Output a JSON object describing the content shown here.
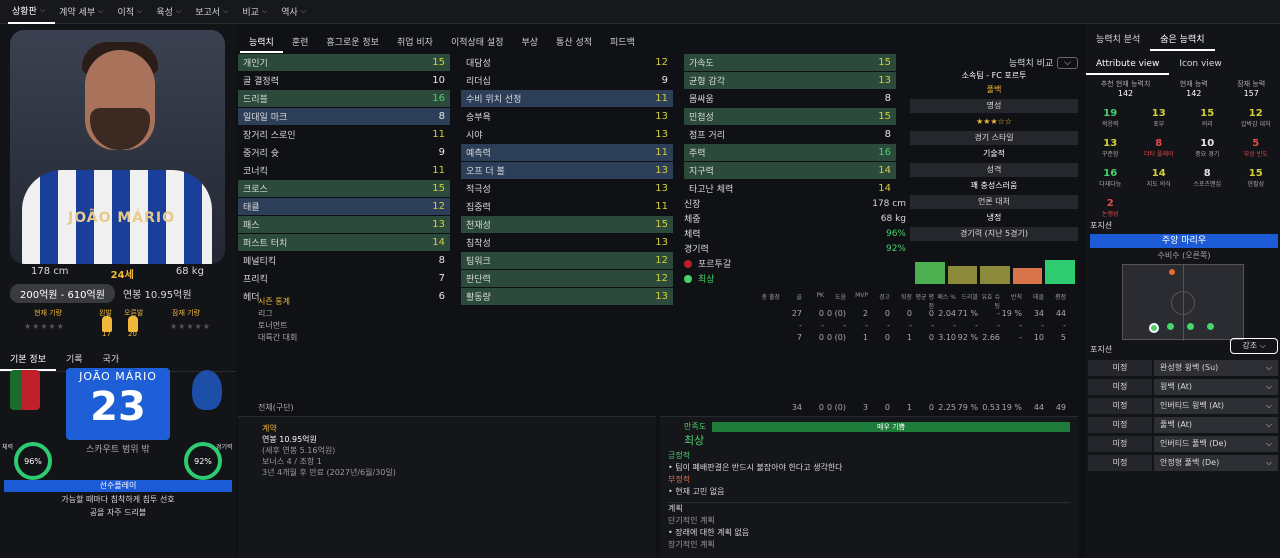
{
  "topnav": [
    "상황판",
    "계약 세부",
    "이적",
    "육성",
    "보고서",
    "비교",
    "역사"
  ],
  "player": {
    "name": "JOÃO MÁRIO",
    "height": "178 cm",
    "age": "24세",
    "weight": "68 kg",
    "value": "200억원 - 610억원",
    "wage": "연봉 10.95억원",
    "cur_label": "현재 기량",
    "left_foot": "왼발",
    "right_foot": "오른발",
    "left_val": "17",
    "right_val": "20",
    "pot_label": "잠재 기량",
    "number": "23",
    "scout": "스카우트 범위 밖",
    "cond_label": "체력",
    "cond": "96%",
    "sharp_label": "경기력",
    "sharp": "92%",
    "playstyle": "선수플레이",
    "ps_desc1": "가능할 때마다 침착하게 침투 선호",
    "ps_desc2": "공을 자주 드리블"
  },
  "lefttabs": [
    "기본 정보",
    "기록",
    "국가"
  ],
  "midtabs": [
    "능력치",
    "훈련",
    "흥그로운 정보",
    "취업 비자",
    "이적상태 설정",
    "부상",
    "통산 성적",
    "피드백"
  ],
  "col1": [
    [
      "개인기",
      "15",
      "hl1",
      "vy"
    ],
    [
      "골 결정력",
      "10",
      "",
      "vw"
    ],
    [
      "드리블",
      "16",
      "hl1",
      "vg"
    ],
    [
      "일대일 마크",
      "8",
      "hl2",
      "vw"
    ],
    [
      "장거리 스로인",
      "11",
      "",
      "vy"
    ],
    [
      "중거리 슛",
      "9",
      "",
      "vw"
    ],
    [
      "코너킥",
      "11",
      "",
      "vy"
    ],
    [
      "크로스",
      "15",
      "hl1",
      "vy"
    ],
    [
      "태클",
      "12",
      "hl2",
      "vy"
    ],
    [
      "패스",
      "13",
      "hl1",
      "vy"
    ],
    [
      "퍼스트 터치",
      "14",
      "hl1",
      "vy"
    ],
    [
      "페널티킥",
      "8",
      "",
      "vw"
    ],
    [
      "프리킥",
      "7",
      "",
      "vw"
    ],
    [
      "헤더",
      "6",
      "",
      "vw"
    ]
  ],
  "col2": [
    [
      "대담성",
      "12",
      "",
      "vy"
    ],
    [
      "리더십",
      "9",
      "",
      "vw"
    ],
    [
      "수비 위치 선정",
      "11",
      "hl2",
      "vy"
    ],
    [
      "승부욕",
      "13",
      "",
      "vy"
    ],
    [
      "시야",
      "13",
      "",
      "vy"
    ],
    [
      "예측력",
      "11",
      "hl2",
      "vy"
    ],
    [
      "오프 더 볼",
      "13",
      "hl2",
      "vy"
    ],
    [
      "적극성",
      "13",
      "",
      "vy"
    ],
    [
      "집중력",
      "11",
      "",
      "vy"
    ],
    [
      "천재성",
      "15",
      "hl1",
      "vy"
    ],
    [
      "침착성",
      "13",
      "",
      "vy"
    ],
    [
      "팀워크",
      "12",
      "hl1",
      "vy"
    ],
    [
      "판단력",
      "12",
      "hl1",
      "vy"
    ],
    [
      "활동량",
      "13",
      "hl1",
      "vy"
    ]
  ],
  "col3": [
    [
      "가속도",
      "15",
      "hl1",
      "vy"
    ],
    [
      "균형 감각",
      "13",
      "hl1",
      "vy"
    ],
    [
      "몸싸움",
      "8",
      "",
      "vw"
    ],
    [
      "민첩성",
      "15",
      "hl1",
      "vy"
    ],
    [
      "점프 거리",
      "8",
      "",
      "vw"
    ],
    [
      "주력",
      "16",
      "hl1",
      "vg"
    ],
    [
      "지구력",
      "14",
      "hl1",
      "vy"
    ],
    [
      "타고난 체력",
      "14",
      "",
      "vy"
    ]
  ],
  "bio": [
    [
      "신장",
      "178 cm"
    ],
    [
      "체중",
      "68 kg"
    ],
    [
      "체력",
      "96%"
    ],
    [
      "경기력",
      "92%"
    ],
    [
      "",
      "포르투갈"
    ],
    [
      "",
      "최상"
    ]
  ],
  "rightattr": {
    "compare": "능력치 비교",
    "club": "소속팀 - FC 포르투",
    "pos": "풀백",
    "rep": "명성",
    "style_t": "경기 스타일",
    "style": "기술적",
    "pers_t": "성격",
    "pers": "꽤 충성스러움",
    "media_t": "언론 대처",
    "media": "냉정",
    "form_t": "경기력 (지난 5경기)"
  },
  "season": {
    "title": "시즌 통계",
    "headers": [
      "총 출장",
      "골",
      "PK",
      "도움",
      "MVP",
      "경고",
      "퇴장",
      "평균 평점",
      "패스 %",
      "드리블",
      "유효 슈팅",
      "반칙",
      "태클",
      "평점"
    ],
    "rows": [
      [
        "리그",
        "27",
        "0",
        "0 (0)",
        "2",
        "0",
        "0",
        "0",
        "2.04",
        "71 %",
        "-",
        "19 %",
        "34",
        "44"
      ],
      [
        "토너먼트",
        "-",
        "-",
        "-",
        "-",
        "-",
        "-",
        "-",
        "-",
        "-",
        "-",
        "-",
        "-",
        "-"
      ],
      [
        "대륙간 대회",
        "7",
        "0",
        "0 (0)",
        "1",
        "0",
        "1",
        "0",
        "3.10",
        "92 %",
        "2.66",
        "-",
        "10",
        "5"
      ]
    ],
    "total": [
      "전체(구단)",
      "34",
      "0",
      "0 (0)",
      "3",
      "0",
      "1",
      "0",
      "2.25",
      "79 %",
      "0.53",
      "19 %",
      "44",
      "49"
    ]
  },
  "contract": {
    "title": "계약",
    "wage": "연봉 10.95억원",
    "after": "(세후 연봉 5.16억원)",
    "bonus": "보너스 4 / 조항 1",
    "expire": "3년 4개월 후 만료 (2027년/6월/30일)"
  },
  "satis": {
    "title": "만족도",
    "level": "최상",
    "bar": "매우 기쁨",
    "pos_t": "긍정적",
    "pos": "팀이 폐배판결은 반드시 불잡아야 한다고 생각한다",
    "neg_t": "부정적",
    "neg": "현재 고민 없음",
    "plan_t": "계획",
    "short_t": "단기적인 계획",
    "short": "장래에 대한 계획 없음",
    "long_t": "장기적인 계획"
  },
  "rightpanel": {
    "tabs": [
      "능력치 분석",
      "숨은 능력치"
    ],
    "subtabs": [
      "Attribute view",
      "Icon view"
    ],
    "abil": [
      [
        "추천 현재 능력치",
        "142"
      ],
      [
        "현재 능력",
        "142"
      ],
      [
        "잠재 능력",
        "157"
      ]
    ],
    "hidden": [
      [
        "19",
        "적응력",
        "vg"
      ],
      [
        "13",
        "포부",
        "vy"
      ],
      [
        "15",
        "의리",
        "vy"
      ],
      [
        "12",
        "압박감 대처",
        "vy"
      ],
      [
        "13",
        "꾸준함",
        "vy"
      ],
      [
        "8",
        "더티 플레이",
        "red"
      ],
      [
        "10",
        "중요 경기",
        "vw"
      ],
      [
        "5",
        "부상 빈도",
        "red"
      ],
      [
        "16",
        "다재다능",
        "vg"
      ],
      [
        "14",
        "지도 의식",
        "vy"
      ],
      [
        "8",
        "스포츠맨십",
        "vw"
      ],
      [
        "15",
        "현필성",
        "vy"
      ],
      [
        "2",
        "논쟁성",
        "red"
      ]
    ],
    "pos_t": "포지션",
    "pos_main": "주앙 마리우",
    "pos_sub": "수비수 (오른쪽)",
    "pos2_t": "포지션",
    "sel": "강조",
    "roles": [
      [
        "미정",
        "완성형 윙백 (Su)"
      ],
      [
        "미정",
        "윙백 (At)"
      ],
      [
        "미정",
        "인버티드 윙백 (At)"
      ],
      [
        "미정",
        "풀백 (At)"
      ],
      [
        "미정",
        "인버티드 풀백 (De)"
      ],
      [
        "미정",
        "안정형 풀백 (De)"
      ]
    ]
  },
  "colors": {
    "hl1": "#2b4a3b",
    "hl2": "#2d3f58",
    "yellow": "#d2cf39",
    "green": "#49d26a",
    "blue": "#1d5bd6",
    "orange": "#f0b93a"
  }
}
